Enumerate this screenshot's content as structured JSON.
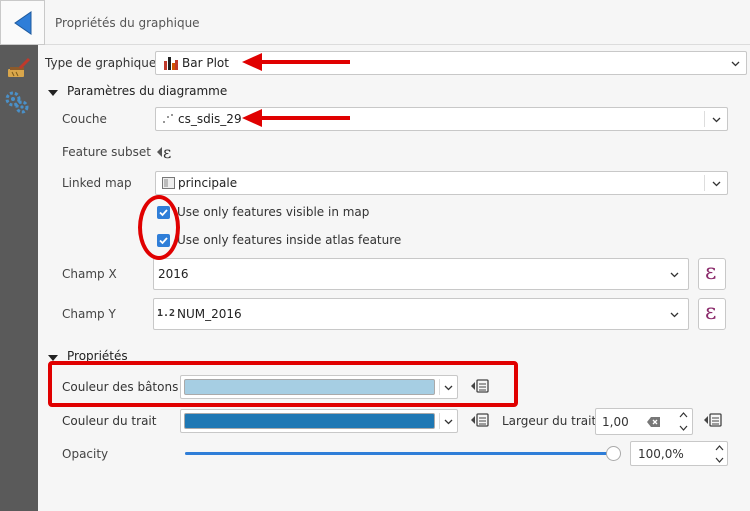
{
  "header": {
    "title": "Propriétés du graphique"
  },
  "chart_type": {
    "label": "Type de graphique",
    "value": "Bar Plot"
  },
  "diagram_params": {
    "title": "Paramètres du diagramme",
    "layer": {
      "label": "Couche",
      "value": "cs_sdis_29"
    },
    "feature_subset": {
      "label": "Feature subset"
    },
    "linked_map": {
      "label": "Linked map",
      "value": "principale"
    },
    "checks": [
      {
        "label": "Use only features visible in map",
        "checked": true
      },
      {
        "label": "Use only features inside atlas feature",
        "checked": true
      }
    ],
    "field_x": {
      "label": "Champ X",
      "value": "2016"
    },
    "field_y": {
      "label": "Champ Y",
      "type_badge": "1.2",
      "value": "NUM_2016"
    }
  },
  "properties": {
    "title": "Propriétés",
    "bar_color": {
      "label": "Couleur des bâtons",
      "color": "#a6cee3"
    },
    "stroke_color": {
      "label": "Couleur du trait",
      "color": "#1f78b4"
    },
    "stroke_width": {
      "label": "Largeur du trait",
      "value": "1,00"
    },
    "opacity": {
      "label": "Opacity",
      "value": "100,0%",
      "level": 1.0
    }
  },
  "colors": {
    "accent": "#2f7ed8",
    "annotation_red": "#e00000",
    "expression": "#8a2a6a"
  }
}
